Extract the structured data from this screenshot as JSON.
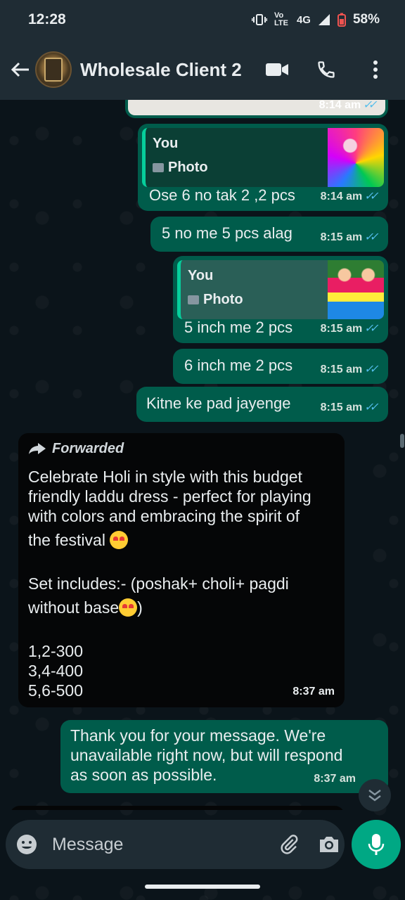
{
  "status_bar": {
    "time": "12:28",
    "network": "4G",
    "battery": "58%",
    "volte": "Vo LTE"
  },
  "header": {
    "contact_name": "Wholesale Client 2",
    "icons": [
      "back-arrow-icon",
      "video-call-icon",
      "voice-call-icon",
      "more-options-icon"
    ]
  },
  "messages": [
    {
      "id": "m0",
      "direction": "out",
      "time": "8:14 am",
      "ticks": "read"
    },
    {
      "id": "m1",
      "direction": "out",
      "reply_author": "You",
      "reply_kind": "Photo",
      "text": "Ose 6 no tak 2 ,2 pcs",
      "time": "8:14 am",
      "ticks": "read"
    },
    {
      "id": "m2",
      "direction": "out",
      "text": "5 no me 5 pcs alag",
      "time": "8:15 am",
      "ticks": "read"
    },
    {
      "id": "m3",
      "direction": "out",
      "reply_author": "You",
      "reply_kind": "Photo",
      "text": "5 inch me 2 pcs",
      "time": "8:15 am",
      "ticks": "read"
    },
    {
      "id": "m4",
      "direction": "out",
      "text": "6 inch me 2 pcs",
      "time": "8:15 am",
      "ticks": "read"
    },
    {
      "id": "m5",
      "direction": "out",
      "text": "Kitne ke pad jayenge",
      "time": "8:15 am",
      "ticks": "read"
    },
    {
      "id": "m6",
      "direction": "in",
      "forwarded_label": "Forwarded",
      "lines": [
        "Celebrate Holi in style with this budget",
        "friendly laddu dress - perfect for playing",
        "with colors and embracing the spirit of",
        "the festival",
        "",
        "Set includes:- (poshak+ choli+ pagdi",
        "without base",
        "",
        "1,2-300",
        "3,4-400",
        "5,6-500"
      ],
      "time": "8:37 am"
    },
    {
      "id": "m7",
      "direction": "out",
      "lines": [
        "Thank you for your message. We're",
        "unavailable right now, but will respond",
        "as soon as possible."
      ],
      "time": "8:37 am"
    }
  ],
  "composer": {
    "placeholder": "Message",
    "icons": [
      "emoji-icon",
      "attach-icon",
      "camera-icon",
      "microphone-icon"
    ]
  },
  "colors": {
    "outgoing_bubble": "#005c4b",
    "incoming_bubble": "#050607",
    "accent": "#00a884",
    "read_ticks": "#53bdeb"
  }
}
